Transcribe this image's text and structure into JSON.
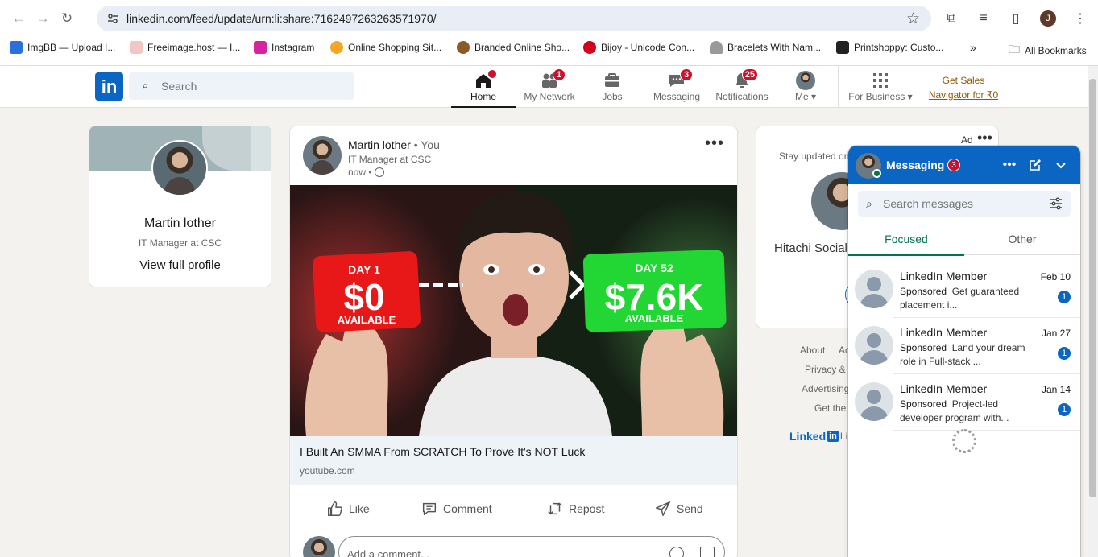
{
  "browser": {
    "url": "linkedin.com/feed/update/urn:li:share:7162497263263571970/",
    "profile_initial": "J",
    "bookmarks": [
      {
        "label": "ImgBB — Upload I...",
        "color": "#2a6fdb"
      },
      {
        "label": "Freeimage.host — I...",
        "color": "#e8a0a0"
      },
      {
        "label": "Instagram",
        "color": "#d6249f"
      },
      {
        "label": "Online Shopping Sit...",
        "color": "#f5a623"
      },
      {
        "label": "Branded Online Sho...",
        "color": "#8b5a2b"
      },
      {
        "label": "Bijoy - Unicode Con...",
        "color": "#d0021b"
      },
      {
        "label": "Bracelets With Nam...",
        "color": "#777777"
      },
      {
        "label": "Printshoppy: Custo...",
        "color": "#222222"
      }
    ],
    "all_bookmarks": "All Bookmarks"
  },
  "header": {
    "logo": "in",
    "search_placeholder": "Search",
    "nav": [
      {
        "label": "Home",
        "badge": ""
      },
      {
        "label": "My Network",
        "badge": "1"
      },
      {
        "label": "Jobs",
        "badge": ""
      },
      {
        "label": "Messaging",
        "badge": "3"
      },
      {
        "label": "Notifications",
        "badge": "25"
      },
      {
        "label": "Me ▾",
        "badge": ""
      },
      {
        "label": "For Business ▾",
        "badge": ""
      }
    ],
    "sales_line1": "Get Sales",
    "sales_line2": "Navigator for ₹0"
  },
  "profile": {
    "name": "Martin lother",
    "title": "IT Manager at CSC",
    "link": "View full profile"
  },
  "post": {
    "author": "Martin lother",
    "you": " • You",
    "subtitle": "IT Manager at CSC",
    "time": "now • ",
    "thumb": {
      "day1": "DAY 1",
      "amount1": "$0",
      "avail1": "AVAILABLE",
      "day52": "DAY 52",
      "amount2": "$7.6K",
      "avail2": "AVAILABLE"
    },
    "link_title": "I Built An SMMA From SCRATCH To Prove It's NOT Luck",
    "link_domain": "youtube.com",
    "actions": [
      "Like",
      "Comment",
      "Repost",
      "Send"
    ],
    "comment_placeholder": "Add a comment..."
  },
  "ad": {
    "label": "Ad",
    "stay": "Stay updated on",
    "company": "Hitachi Social"
  },
  "footer": {
    "links": [
      "About",
      "Ac",
      "Privacy &",
      "Advertising",
      "Get the"
    ],
    "logo_text": "Linked",
    "logo_in": "in",
    "logo_suffix": "Li"
  },
  "messaging": {
    "title": "Messaging",
    "badge": "3",
    "search_placeholder": "Search messages",
    "tabs": [
      "Focused",
      "Other"
    ],
    "conversations": [
      {
        "name": "LinkedIn Member",
        "date": "Feb 10",
        "tag": "Sponsored",
        "preview": "Get guaranteed placement i...",
        "unread": "1"
      },
      {
        "name": "LinkedIn Member",
        "date": "Jan 27",
        "tag": "Sponsored",
        "preview": "Land your dream role in Full-stack ...",
        "unread": "1"
      },
      {
        "name": "LinkedIn Member",
        "date": "Jan 14",
        "tag": "Sponsored",
        "preview": "Project-led developer program with...",
        "unread": "1"
      }
    ]
  }
}
